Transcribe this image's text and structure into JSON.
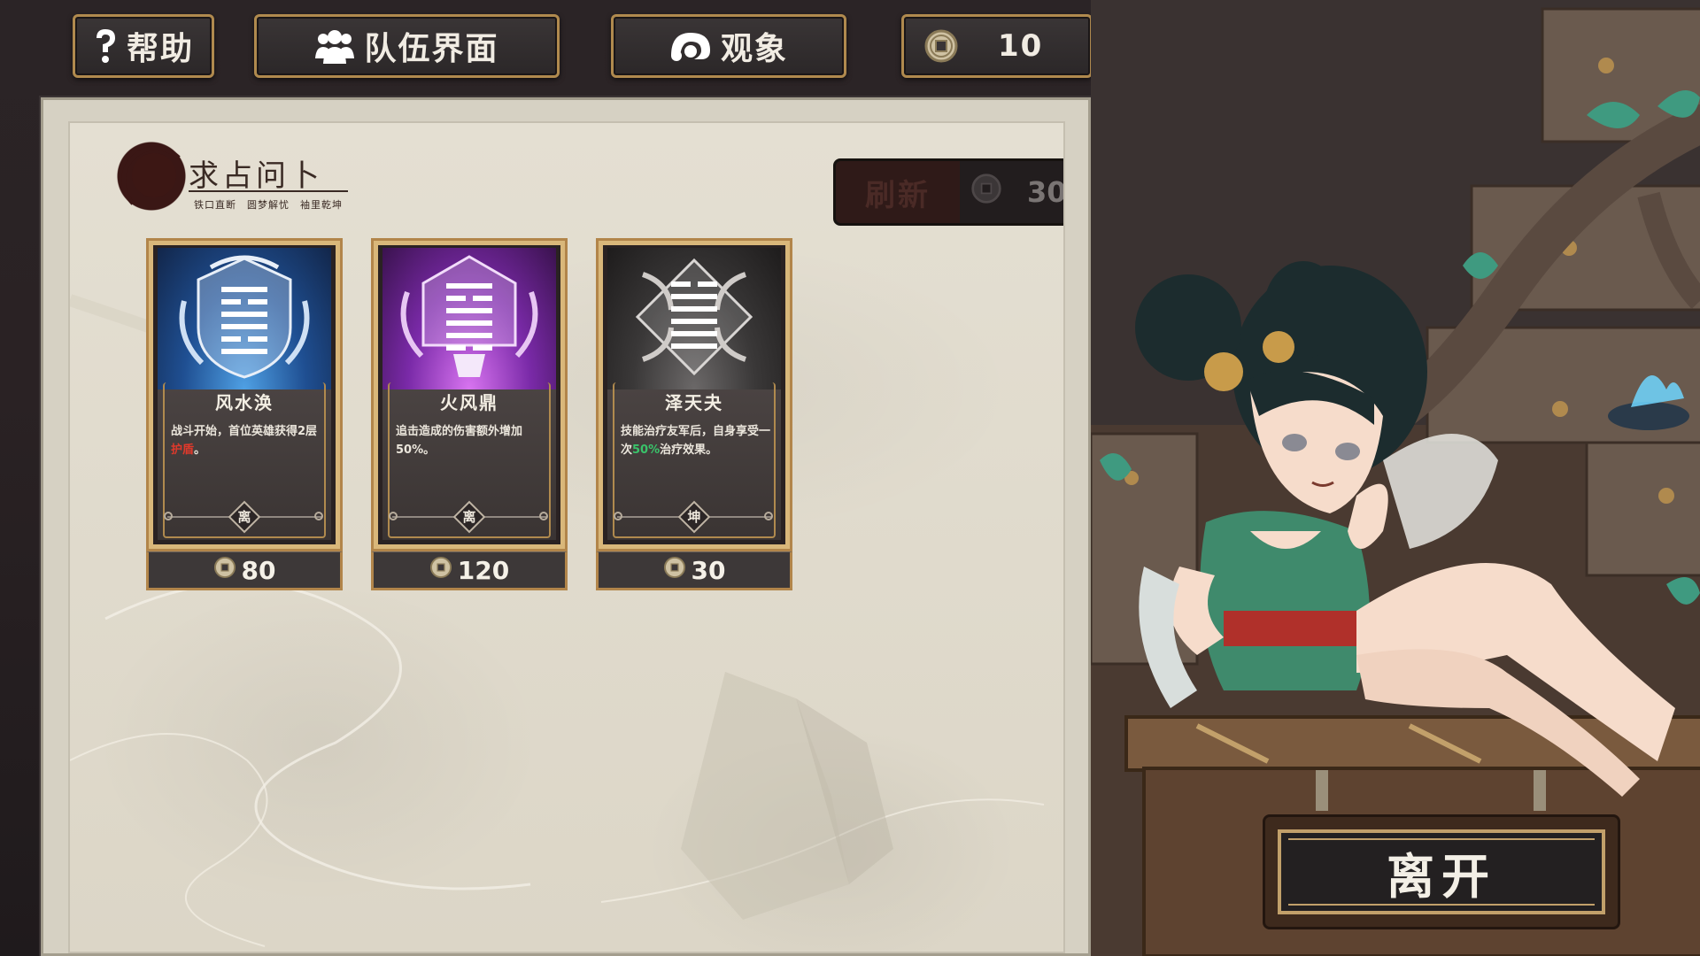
{
  "topbar": {
    "help_label": "帮助",
    "team_label": "队伍界面",
    "observe_label": "观象",
    "coins": "10"
  },
  "panel": {
    "title": "求占问卜",
    "subtitle": "铁口直断　圆梦解忧　袖里乾坤",
    "refresh_label": "刷新",
    "refresh_cost": "30"
  },
  "cards": [
    {
      "name": "风水涣",
      "desc_a": "战斗开始，首位英雄获得2层",
      "desc_hl": "护盾",
      "desc_b": "。",
      "tag": "离",
      "price": "80",
      "theme": "blue"
    },
    {
      "name": "火风鼎",
      "desc_a": "追击造成的伤害额外增加50%。",
      "desc_hl": "",
      "desc_b": "",
      "tag": "离",
      "price": "120",
      "theme": "purple"
    },
    {
      "name": "泽天夬",
      "desc_a": "技能治疗友军后，自身享受一次",
      "desc_hl": "50%",
      "desc_b": "治疗效果。",
      "tag": "坤",
      "price": "30",
      "theme": "black"
    }
  ],
  "leave_label": "离开",
  "colors": {
    "gold_border": "#b08a4e",
    "panel_bg": "#dcd6c7",
    "highlight_red": "#e0392b",
    "highlight_green": "#39c36a"
  }
}
